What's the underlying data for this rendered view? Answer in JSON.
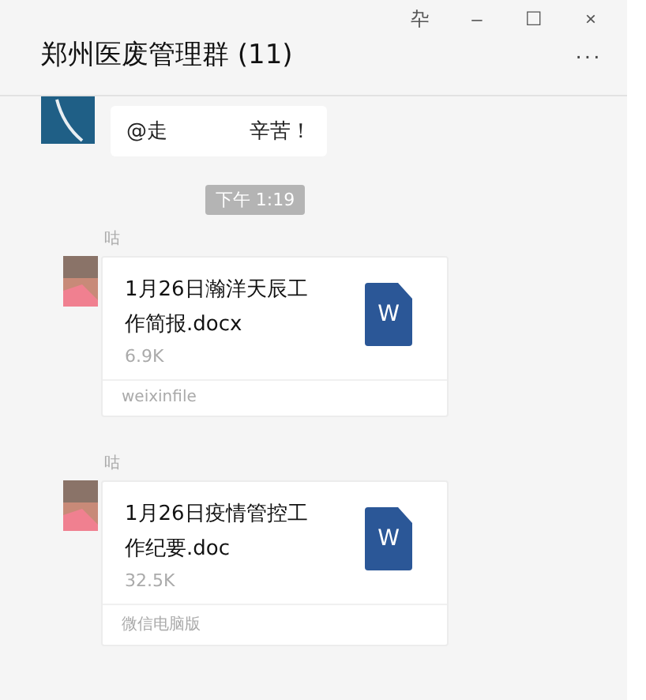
{
  "window": {
    "title": "郑州医废管理群 (11)",
    "controls": [
      "卆",
      "–",
      "☐",
      "×"
    ],
    "more": "···"
  },
  "messages": [
    {
      "kind": "text",
      "text_before": "@走",
      "text_after": "辛苦！"
    },
    {
      "kind": "time",
      "text": "下午 1:19"
    },
    {
      "kind": "file",
      "sender": "咕",
      "file_name": "1月26日瀚洋天辰工作简报.docx",
      "size": "6.9K",
      "source": "weixinfile",
      "file_icon": "W"
    },
    {
      "kind": "file",
      "sender": "咕",
      "file_name": "1月26日疫情管控工作纪要.doc",
      "size": "32.5K",
      "source": "微信电脑版",
      "file_icon": "W"
    }
  ]
}
